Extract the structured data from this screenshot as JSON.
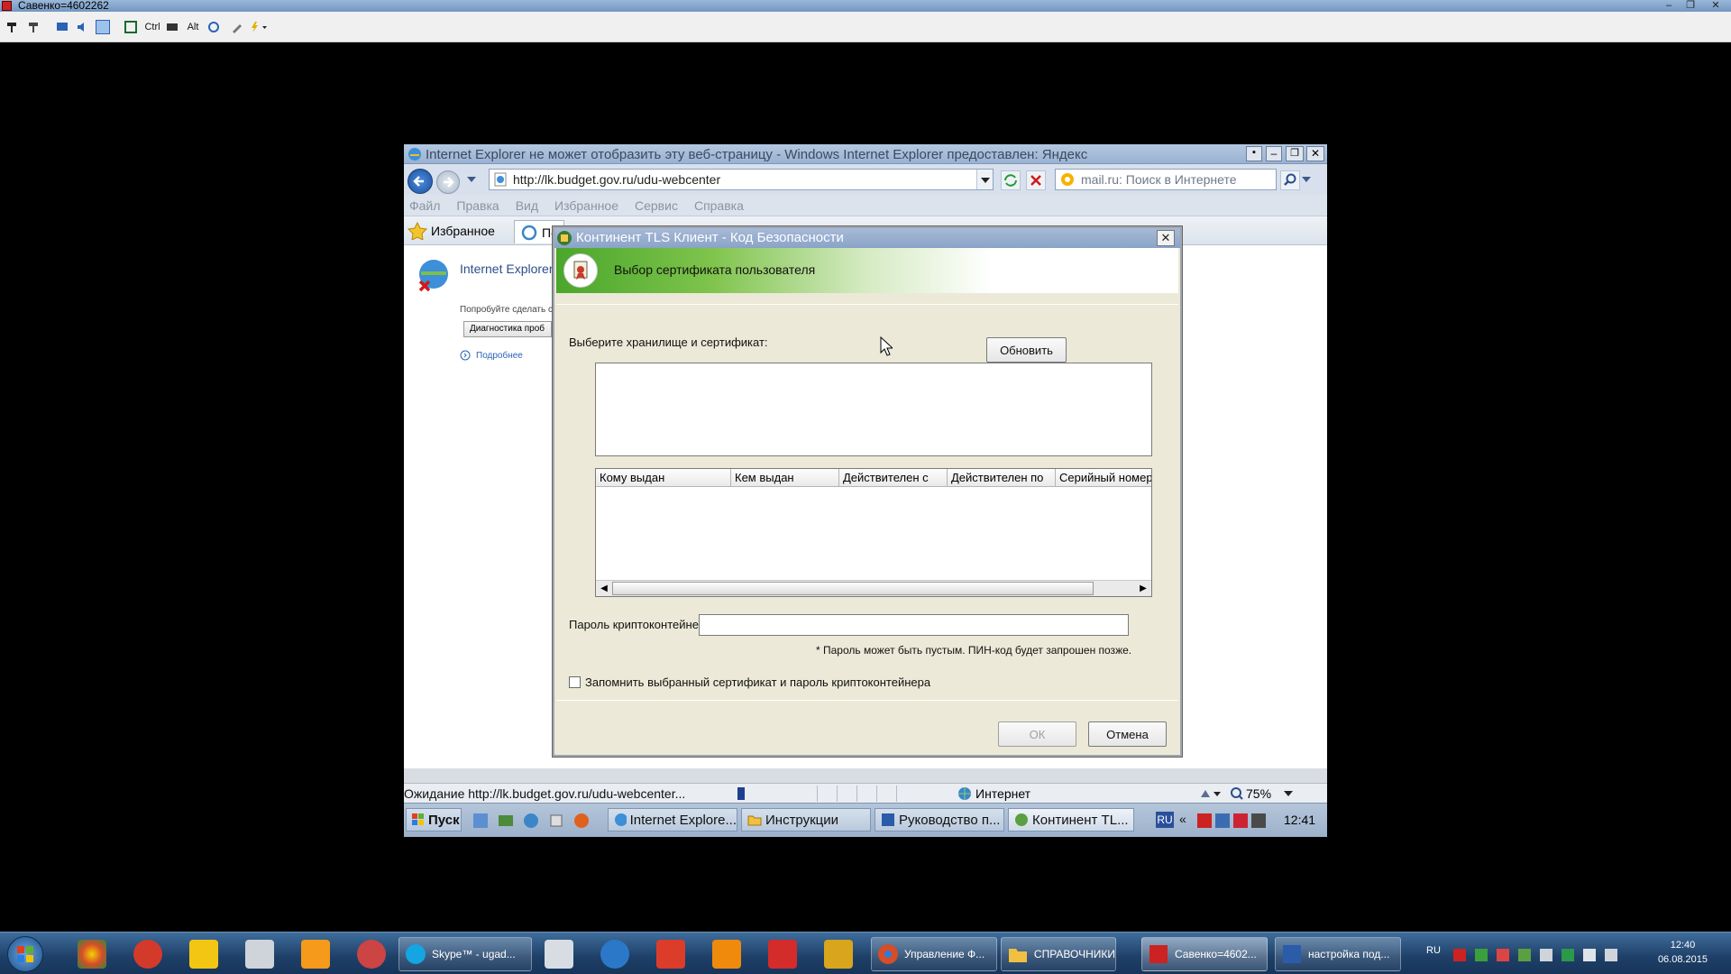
{
  "rdp": {
    "title": "Савенко=4602262",
    "toolbar": [
      "Ctrl",
      "Alt"
    ]
  },
  "ie": {
    "title": "Internet Explorer не может отобразить эту веб-страницу - Windows Internet Explorer предоставлен: Яндекс",
    "url": "http://lk.budget.gov.ru/udu-webcenter",
    "search_placeholder": "mail.ru: Поиск в Интернете",
    "menu": [
      "Файл",
      "Правка",
      "Вид",
      "Избранное",
      "Сервис",
      "Справка"
    ],
    "favorites_label": "Избранное",
    "tab_label": "По",
    "content": {
      "heading": "Internet Explorer",
      "hint": "Попробуйте сделать с",
      "diag_button": "Диагностика проб",
      "more_link": "Подробнее"
    },
    "status": {
      "text": "Ожидание http://lk.budget.gov.ru/udu-webcenter...",
      "zone": "Интернет",
      "zoom": "75%"
    }
  },
  "remote_taskbar": {
    "start": "Пуск",
    "tasks": [
      "Internet Explore...",
      "Инструкции",
      "Руководство п...",
      "Континент TL..."
    ],
    "lang": "RU",
    "time": "12:41"
  },
  "dialog": {
    "title": "Континент TLS Клиент - Код Безопасности",
    "banner": "Выбор сертификата пользователя",
    "store_label": "Выберите хранилище и сертификат:",
    "refresh_button": "Обновить",
    "columns": [
      "Кому выдан",
      "Кем выдан",
      "Действителен с",
      "Действителен по",
      "Серийный номер"
    ],
    "password_label": "Пароль криптоконтейнера* :",
    "password_value": "",
    "password_note": "* Пароль может быть пустым. ПИН-код будет запрошен позже.",
    "remember_label": "Запомнить выбранный сертификат и пароль криптоконтейнера",
    "remember_checked": false,
    "ok_button": "ОК",
    "cancel_button": "Отмена"
  },
  "taskbar": {
    "buttons": [
      "Skype™ - ugad...",
      "Управление Ф...",
      "СПРАВОЧНИКИ",
      "Савенко=4602...",
      "настройка под..."
    ],
    "lang": "RU",
    "time": "12:40",
    "date": "06.08.2015"
  }
}
